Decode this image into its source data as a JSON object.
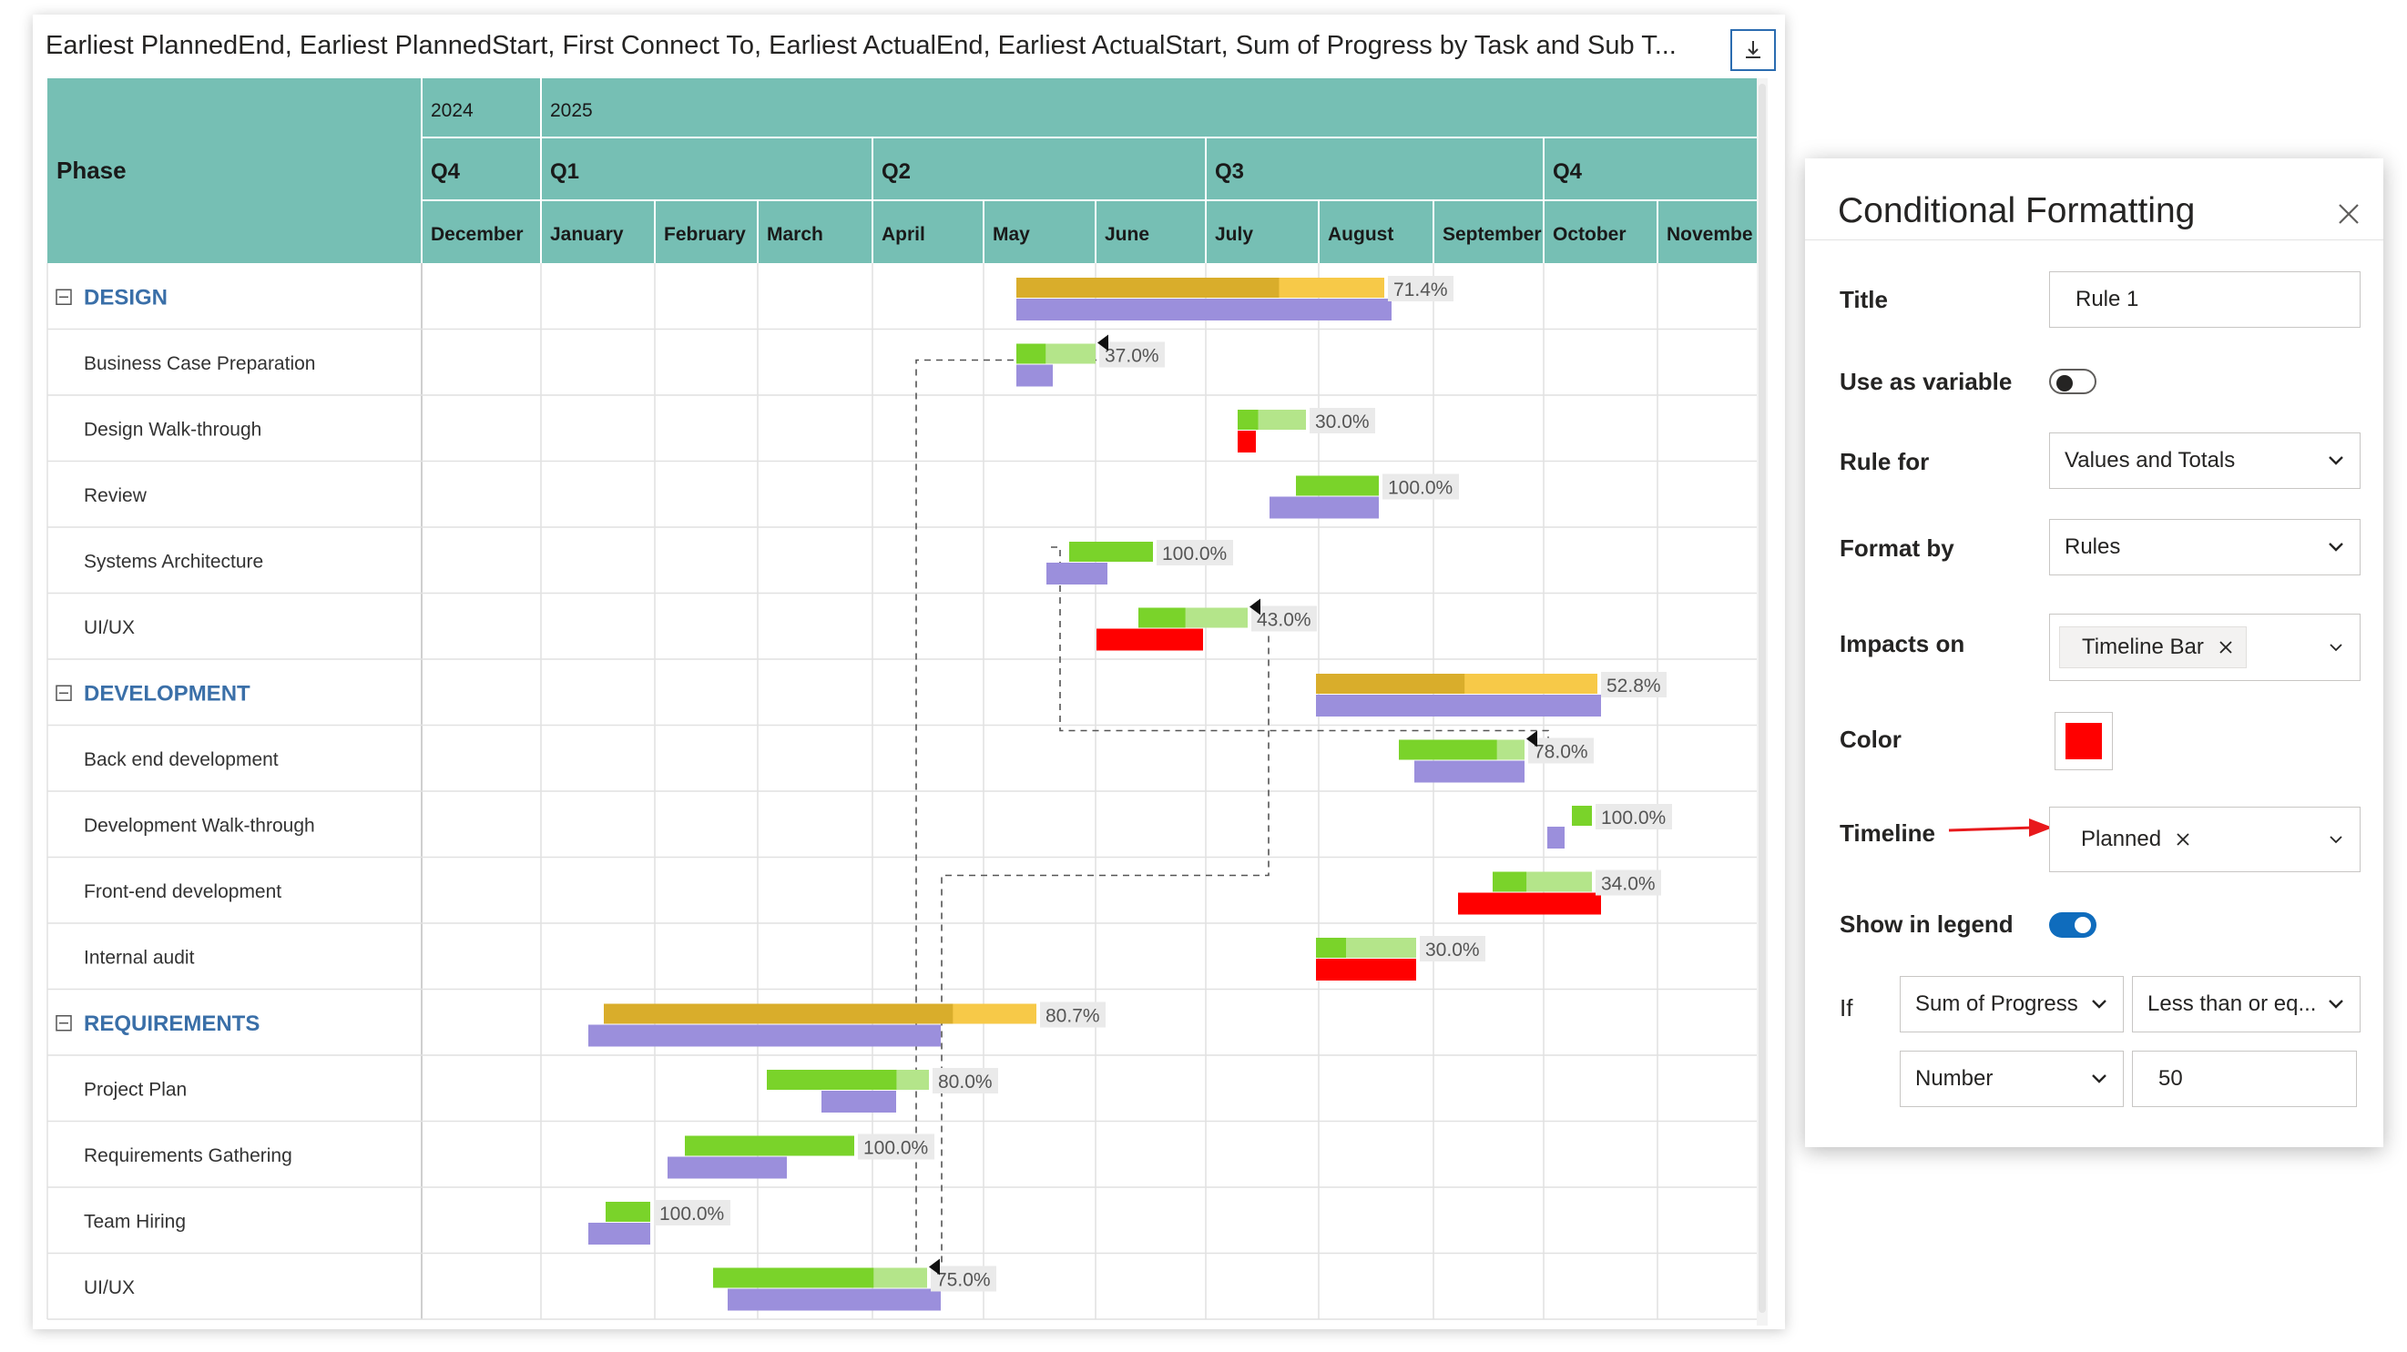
{
  "visual": {
    "title": "Earliest PlannedEnd, Earliest PlannedStart, First Connect To, Earliest ActualEnd, Earliest ActualStart, Sum of Progress by Task and Sub T...",
    "focus_icon": "focus-mode-icon",
    "phase_header": "Phase",
    "years": [
      "2024",
      "2025"
    ],
    "quarters": [
      "Q4",
      "Q1",
      "Q2",
      "Q3",
      "Q4"
    ],
    "months": [
      "December",
      "January",
      "February",
      "March",
      "April",
      "May",
      "June",
      "July",
      "August",
      "September",
      "October",
      "Novembe"
    ],
    "colors": {
      "header_bg": "#76bfb4",
      "group_text": "#3a6fa8",
      "planned_bar": "#9b8fdc",
      "progress_done": "#7ad32a",
      "progress_remaining": "#b4e58a",
      "summary_done": "#d9ad2b",
      "summary_remaining": "#f7c948",
      "rule_color": "#ff0000",
      "label_bg": "#eaeaea"
    },
    "rows": [
      {
        "label": "DESIGN",
        "group": true,
        "progress_label": "71.4%"
      },
      {
        "label": "Business Case Preparation",
        "group": false,
        "progress_label": "37.0%"
      },
      {
        "label": "Design Walk-through",
        "group": false,
        "progress_label": "30.0%"
      },
      {
        "label": "Review",
        "group": false,
        "progress_label": "100.0%"
      },
      {
        "label": "Systems Architecture",
        "group": false,
        "progress_label": "100.0%"
      },
      {
        "label": "UI/UX",
        "group": false,
        "progress_label": "43.0%"
      },
      {
        "label": "DEVELOPMENT",
        "group": true,
        "progress_label": "52.8%"
      },
      {
        "label": "Back end development",
        "group": false,
        "progress_label": "78.0%"
      },
      {
        "label": "Development Walk-through",
        "group": false,
        "progress_label": "100.0%"
      },
      {
        "label": "Front-end development",
        "group": false,
        "progress_label": "34.0%"
      },
      {
        "label": "Internal audit",
        "group": false,
        "progress_label": "30.0%"
      },
      {
        "label": "REQUIREMENTS",
        "group": true,
        "progress_label": "80.7%"
      },
      {
        "label": "Project Plan",
        "group": false,
        "progress_label": "80.0%"
      },
      {
        "label": "Requirements Gathering",
        "group": false,
        "progress_label": "100.0%"
      },
      {
        "label": "Team Hiring",
        "group": false,
        "progress_label": "100.0%"
      },
      {
        "label": "UI/UX",
        "group": false,
        "progress_label": "75.0%"
      }
    ]
  },
  "panel": {
    "title": "Conditional Formatting",
    "close_icon": "close-icon",
    "fields": {
      "title_label": "Title",
      "title_value": "Rule 1",
      "use_as_variable_label": "Use as variable",
      "use_as_variable_on": false,
      "rule_for_label": "Rule for",
      "rule_for_value": "Values and Totals",
      "format_by_label": "Format by",
      "format_by_value": "Rules",
      "impacts_on_label": "Impacts on",
      "impacts_on_value": "Timeline Bar",
      "color_label": "Color",
      "color_value": "#ff0000",
      "timeline_label": "Timeline",
      "timeline_value": "Planned",
      "show_in_legend_label": "Show in legend",
      "show_in_legend_on": true,
      "if_label": "If",
      "if_field": "Sum of Progress",
      "if_operator": "Less than or eq...",
      "if_type": "Number",
      "if_value": "50"
    }
  }
}
